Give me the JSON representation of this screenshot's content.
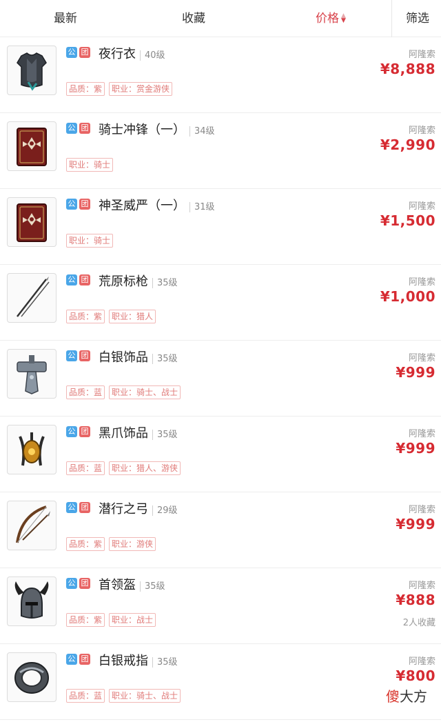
{
  "tabs": {
    "latest": "最新",
    "favorites": "收藏",
    "price": "价格",
    "filter": "筛选"
  },
  "badge_labels": {
    "public": "公",
    "team": "团"
  },
  "items": [
    {
      "name": "夜行衣",
      "level": "40级",
      "tags": [
        "品质：紫",
        "职业：赏金游侠"
      ],
      "seller": "阿隆索",
      "price": "¥8,888",
      "favorites": "",
      "icon": "armor-icon"
    },
    {
      "name": "骑士冲锋（一）",
      "level": "34级",
      "tags": [
        "职业：骑士"
      ],
      "seller": "阿隆索",
      "price": "¥2,990",
      "favorites": "",
      "icon": "spellbook-icon"
    },
    {
      "name": "神圣威严（一）",
      "level": "31级",
      "tags": [
        "职业：骑士"
      ],
      "seller": "阿隆索",
      "price": "¥1,500",
      "favorites": "",
      "icon": "spellbook-icon"
    },
    {
      "name": "荒原标枪",
      "level": "35级",
      "tags": [
        "品质：紫",
        "职业：猎人"
      ],
      "seller": "阿隆索",
      "price": "¥1,000",
      "favorites": "",
      "icon": "javelin-icon"
    },
    {
      "name": "白银饰品",
      "level": "35级",
      "tags": [
        "品质：蓝",
        "职业：骑士、战士"
      ],
      "seller": "阿隆索",
      "price": "¥999",
      "favorites": "",
      "icon": "hammer-amulet-icon"
    },
    {
      "name": "黑爪饰品",
      "level": "35级",
      "tags": [
        "品质：蓝",
        "职业：猎人、游侠"
      ],
      "seller": "阿隆索",
      "price": "¥999",
      "favorites": "",
      "icon": "claw-amulet-icon"
    },
    {
      "name": "潜行之弓",
      "level": "29级",
      "tags": [
        "品质：紫",
        "职业：游侠"
      ],
      "seller": "阿隆索",
      "price": "¥999",
      "favorites": "",
      "icon": "bow-icon"
    },
    {
      "name": "首领盔",
      "level": "35级",
      "tags": [
        "品质：紫",
        "职业：战士"
      ],
      "seller": "阿隆索",
      "price": "¥888",
      "favorites": "2人收藏",
      "icon": "horned-helmet-icon"
    },
    {
      "name": "白银戒指",
      "level": "35级",
      "tags": [
        "品质：蓝",
        "职业：骑士、战士"
      ],
      "seller": "阿隆索",
      "price": "¥800",
      "favorites": "",
      "icon": "ring-icon"
    }
  ],
  "watermark": {
    "part1": "傻",
    "part2": "大方"
  },
  "colors": {
    "accent": "#d62b32",
    "public_badge": "#4aa6e8",
    "team_badge": "#e86464"
  }
}
